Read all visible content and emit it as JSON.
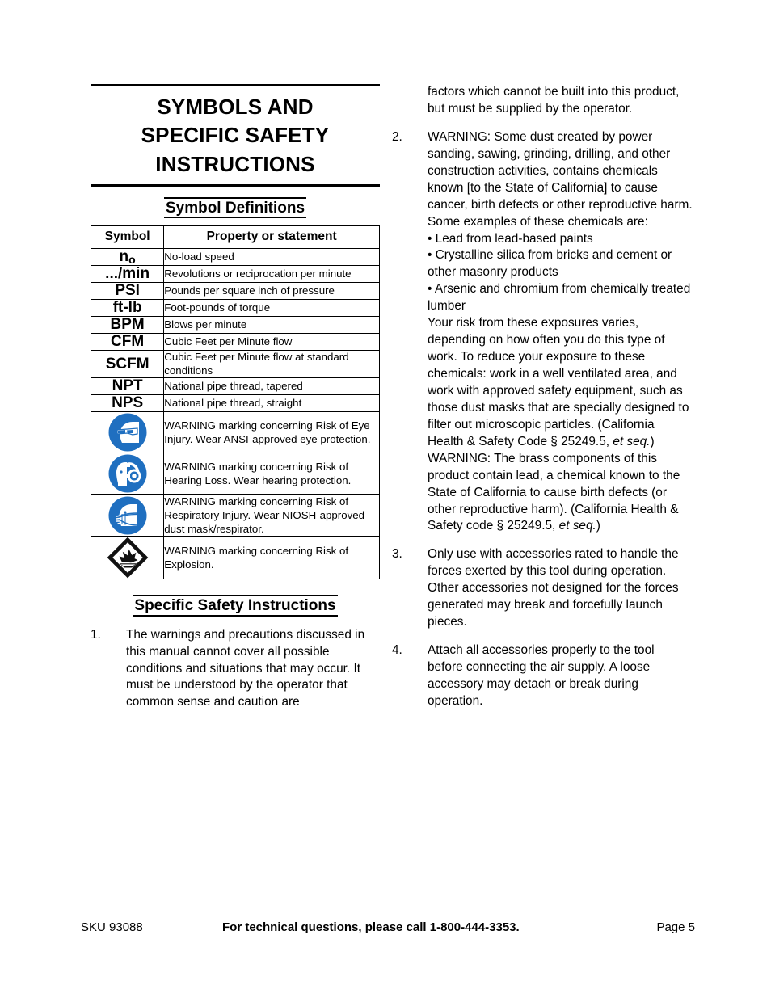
{
  "document": {
    "title_lines": [
      "SYMBOLS AND",
      "SPECIFIC SAFETY",
      "INSTRUCTIONS"
    ],
    "title_text": "SYMBOLS AND SPECIFIC SAFETY INSTRUCTIONS"
  },
  "symbol_section": {
    "heading": "Symbol Definitions",
    "table": {
      "headers": [
        "Symbol",
        "Property or statement"
      ],
      "rows": [
        {
          "symbol": "n",
          "symbol_sub": "o",
          "icon": null,
          "description": "No-load speed"
        },
        {
          "symbol": ".../min",
          "symbol_sub": "",
          "icon": null,
          "description": "Revolutions or reciprocation per minute"
        },
        {
          "symbol": "PSI",
          "symbol_sub": "",
          "icon": null,
          "description": "Pounds per square inch of pressure"
        },
        {
          "symbol": "ft-lb",
          "symbol_sub": "",
          "icon": null,
          "description": "Foot-pounds of torque"
        },
        {
          "symbol": "BPM",
          "symbol_sub": "",
          "icon": null,
          "description": "Blows per minute"
        },
        {
          "symbol": "CFM",
          "symbol_sub": "",
          "icon": null,
          "description": "Cubic Feet per Minute flow"
        },
        {
          "symbol": "SCFM",
          "symbol_sub": "",
          "icon": null,
          "description": "Cubic Feet per Minute flow at standard conditions"
        },
        {
          "symbol": "NPT",
          "symbol_sub": "",
          "icon": null,
          "description": "National pipe thread, tapered"
        },
        {
          "symbol": "NPS",
          "symbol_sub": "",
          "icon": null,
          "description": "National pipe thread, straight"
        },
        {
          "symbol": "",
          "symbol_sub": "",
          "icon": "eye-protection-icon",
          "description": "WARNING marking concerning Risk of Eye Injury.  Wear ANSI-approved eye protection."
        },
        {
          "symbol": "",
          "symbol_sub": "",
          "icon": "hearing-protection-icon",
          "description": "WARNING marking concerning Risk of Hearing Loss.  Wear hearing protection."
        },
        {
          "symbol": "",
          "symbol_sub": "",
          "icon": "respirator-icon",
          "description": "WARNING marking concerning Risk of Respiratory Injury.  Wear NIOSH-approved dust mask/respirator."
        },
        {
          "symbol": "",
          "symbol_sub": "",
          "icon": "explosion-icon",
          "description": "WARNING marking concerning Risk of Explosion."
        }
      ]
    }
  },
  "instructions_section": {
    "heading": "Specific Safety Instructions",
    "items": [
      {
        "number": "1.",
        "text": "The warnings and precautions discussed in this manual cannot cover all possible conditions and situations that may occur.  It must be understood by the operator that common sense and caution are factors which cannot be built into this product, but must be supplied by the operator."
      },
      {
        "number": "2.",
        "text_before_bullets": "WARNING:  Some dust created by power sanding, sawing, grinding, drilling, and other construction activities, contains chemicals known [to the State of California] to cause cancer, birth defects or other reproductive harm.  Some examples of these chemicals are:",
        "bullets": [
          "•  Lead from lead-based paints",
          "•  Crystalline silica from bricks and cement or other masonry products",
          "•  Arsenic and chromium from chemically treated lumber"
        ],
        "text_after_bullets_a": "Your risk from these exposures varies, depending on how often you do this type of work.  To reduce your exposure to these chemicals: work in a well ventilated area, and work with approved safety equipment, such as those dust masks that are specially designed to filter out microscopic particles.  (California Health & Safety Code § 25249.5, ",
        "italic_a": "et seq.",
        "text_after_italic_a": ")",
        "text_after_bullets_b": "WARNING:  The brass components of this product contain lead, a chemical known to the State of California to cause birth defects (or other reproductive harm).  (California Health & Safety code § 25249.5, ",
        "italic_b": "et seq.",
        "text_after_italic_b": ")"
      },
      {
        "number": "3.",
        "text": "Only use with accessories rated to handle the forces exerted by this tool during operation.  Other accessories not designed for the forces generated may break and forcefully launch pieces."
      },
      {
        "number": "4.",
        "text": "Attach all accessories properly to the tool before connecting the air supply.  A loose accessory may detach or break during operation."
      }
    ],
    "item1_first_part": "The warnings and precautions discussed in this manual cannot cover all possible conditions and situations that may occur.  It must be understood by the operator that common sense and caution are",
    "item1_continuation": "factors which cannot be built into this product, but must be supplied by the operator."
  },
  "footer": {
    "sku": "SKU 93088",
    "tech_support": "For technical questions, please call 1-800-444-3353.",
    "page": "Page 5"
  },
  "colors": {
    "icon_blue": "#1f6fc0",
    "text": "#000000",
    "background": "#ffffff"
  }
}
